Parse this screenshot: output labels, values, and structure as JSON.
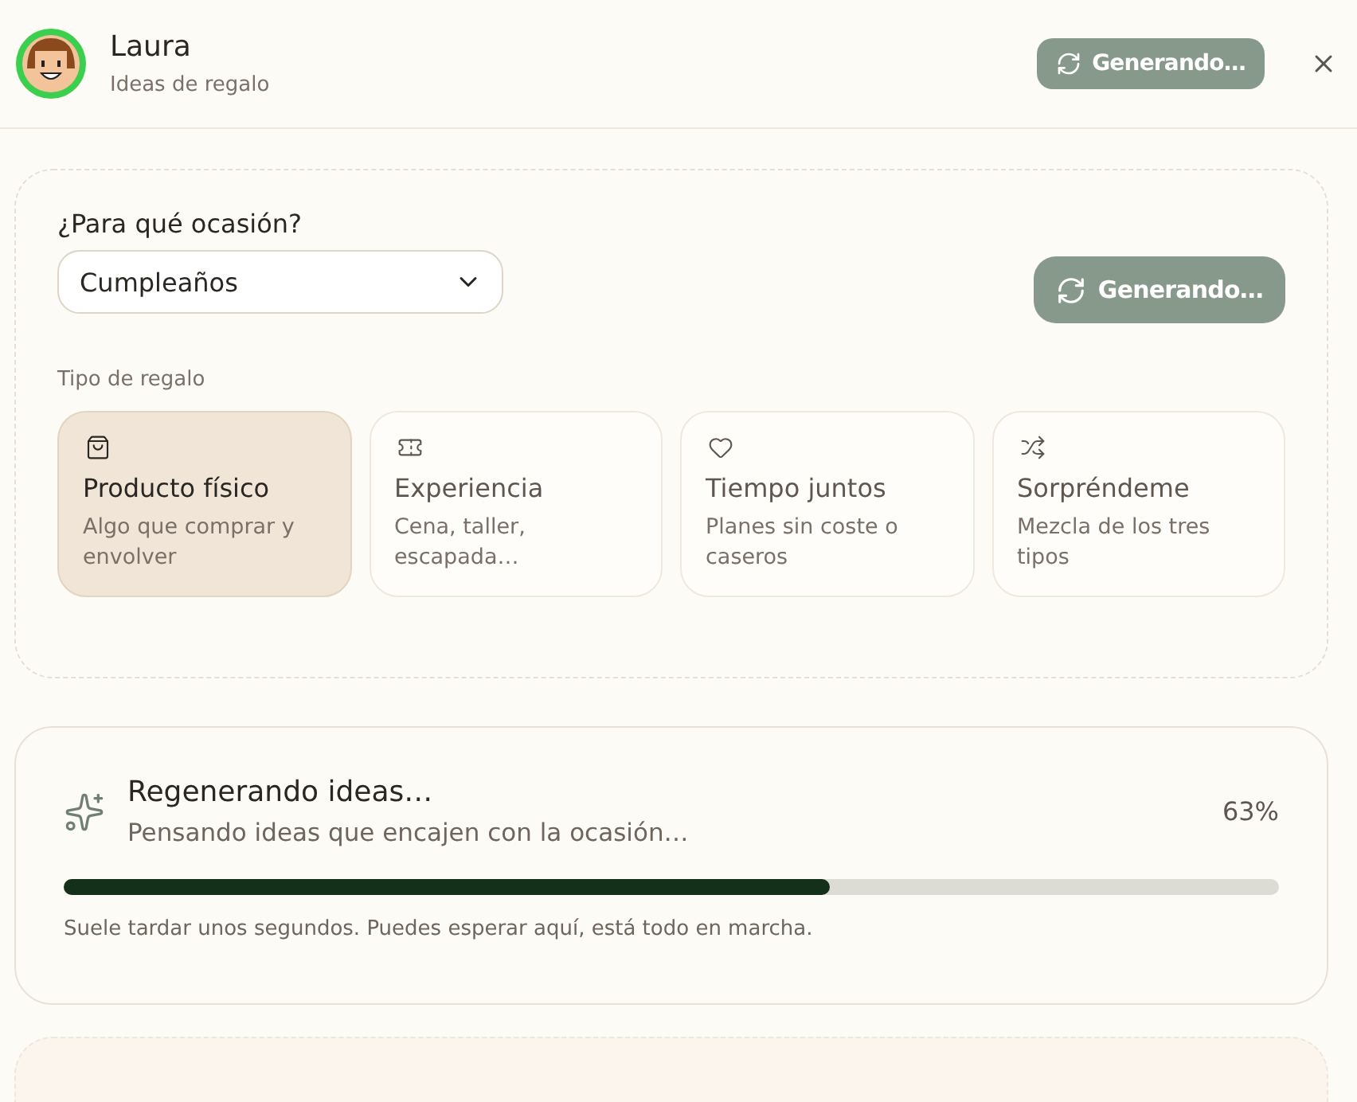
{
  "header": {
    "name": "Laura",
    "subtitle": "Ideas de regalo",
    "button": {
      "label": "Generando…",
      "disabled": true
    }
  },
  "form": {
    "occasion_label": "¿Para qué ocasión?",
    "occasion_value": "Cumpleaños",
    "generate_button": {
      "label": "Generando…",
      "disabled": true
    },
    "type_label": "Tipo de regalo",
    "types": [
      {
        "kind": "bag",
        "title": "Producto físico",
        "description": "Algo que comprar y envolver",
        "selected": true
      },
      {
        "kind": "ticket",
        "title": "Experiencia",
        "description": "Cena, taller, escapada…",
        "selected": false
      },
      {
        "kind": "heart",
        "title": "Tiempo juntos",
        "description": "Planes sin coste o caseros",
        "selected": false
      },
      {
        "kind": "shuffle",
        "title": "Sorpréndeme",
        "description": "Mezcla de los tres tipos",
        "selected": false
      }
    ]
  },
  "progress": {
    "title": "Regenerando ideas…",
    "subtitle": "Pensando ideas que encajen con la ocasión…",
    "reading": "63%",
    "level": 0.63,
    "note": "Suele tardar unos segundos. Puedes esperar aquí, está todo en marcha."
  }
}
